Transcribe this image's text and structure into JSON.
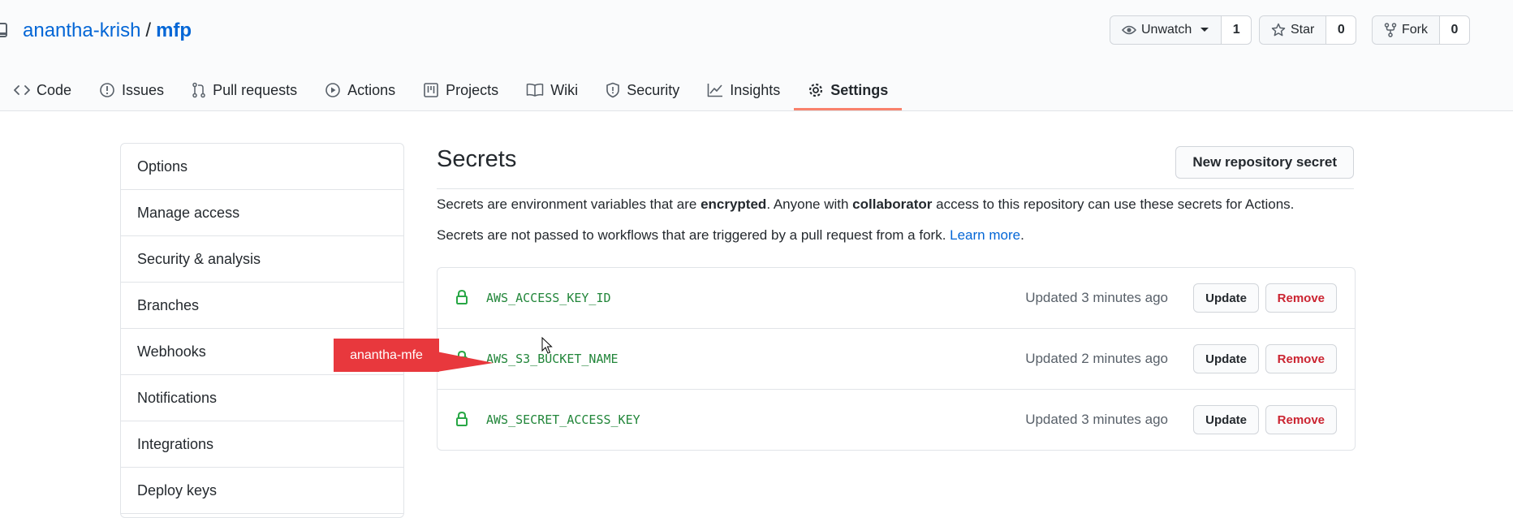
{
  "repo": {
    "owner": "anantha-krish",
    "separator": "/",
    "name": "mfp"
  },
  "actions": {
    "watch": {
      "label": "Unwatch",
      "count": "1"
    },
    "star": {
      "label": "Star",
      "count": "0"
    },
    "fork": {
      "label": "Fork",
      "count": "0"
    }
  },
  "tabs": [
    {
      "label": "Code",
      "icon": "code-icon"
    },
    {
      "label": "Issues",
      "icon": "issue-icon"
    },
    {
      "label": "Pull requests",
      "icon": "pull-request-icon"
    },
    {
      "label": "Actions",
      "icon": "play-icon"
    },
    {
      "label": "Projects",
      "icon": "project-icon"
    },
    {
      "label": "Wiki",
      "icon": "book-icon"
    },
    {
      "label": "Security",
      "icon": "shield-icon"
    },
    {
      "label": "Insights",
      "icon": "graph-icon"
    },
    {
      "label": "Settings",
      "icon": "gear-icon",
      "active": true
    }
  ],
  "sidebar": {
    "items": [
      {
        "label": "Options"
      },
      {
        "label": "Manage access"
      },
      {
        "label": "Security & analysis"
      },
      {
        "label": "Branches"
      },
      {
        "label": "Webhooks"
      },
      {
        "label": "Notifications"
      },
      {
        "label": "Integrations"
      },
      {
        "label": "Deploy keys"
      }
    ]
  },
  "secrets": {
    "title": "Secrets",
    "new_button": "New repository secret",
    "desc1": {
      "part1": "Secrets are environment variables that are ",
      "bold1": "encrypted",
      "part2": ". Anyone with ",
      "bold2": "collaborator",
      "part3": " access to this repository can use these secrets for Actions."
    },
    "desc2": {
      "text": "Secrets are not passed to workflows that are triggered by a pull request from a fork. ",
      "link": "Learn more",
      "end": "."
    },
    "items": [
      {
        "name": "AWS_ACCESS_KEY_ID",
        "updated": "Updated 3 minutes ago",
        "update": "Update",
        "remove": "Remove"
      },
      {
        "name": "AWS_S3_BUCKET_NAME",
        "updated": "Updated 2 minutes ago",
        "update": "Update",
        "remove": "Remove"
      },
      {
        "name": "AWS_SECRET_ACCESS_KEY",
        "updated": "Updated 3 minutes ago",
        "update": "Update",
        "remove": "Remove"
      }
    ]
  },
  "callout": {
    "text": "anantha-mfe"
  },
  "colors": {
    "accent": "#f9826c",
    "link": "#0366d6",
    "secret_name": "#22863a",
    "remove": "#cb2431",
    "callout": "#e8383d"
  }
}
